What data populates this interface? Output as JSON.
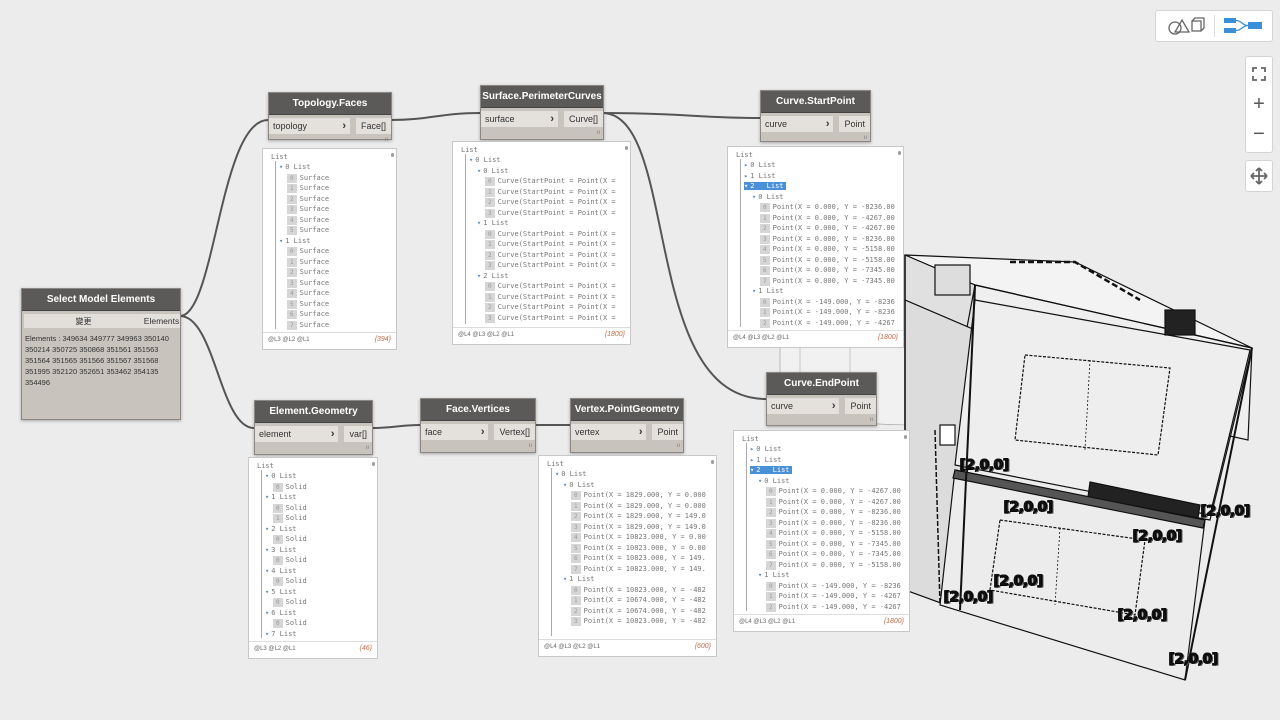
{
  "toolbar": {
    "geometry_view_icon": "shapes-icon",
    "graph_view_icon": "graph-icon",
    "fit_icon": "fit-view-icon",
    "zoom_in_label": "+",
    "zoom_out_label": "−",
    "pan_icon": "pan-icon"
  },
  "nodes": {
    "select_model": {
      "title": "Select Model Elements",
      "button": "變更",
      "output": "Elements",
      "text": "Elements : 349634 349777 349963 350140 350214 350725 350868 351561 351563 351564 351565 351566 351567 351568 351995 352120 352651 353462 354135 354496"
    },
    "topology_faces": {
      "title": "Topology.Faces",
      "input": "topology",
      "output": "Face[]",
      "watch": {
        "header": "List",
        "lines": [
          {
            "t": "▾",
            "lv": 1,
            "idx": "0",
            "text": "List"
          },
          {
            "t": "i",
            "lv": 2,
            "idx": "0",
            "text": "Surface"
          },
          {
            "t": "i",
            "lv": 2,
            "idx": "1",
            "text": "Surface"
          },
          {
            "t": "i",
            "lv": 2,
            "idx": "2",
            "text": "Surface"
          },
          {
            "t": "i",
            "lv": 2,
            "idx": "3",
            "text": "Surface"
          },
          {
            "t": "i",
            "lv": 2,
            "idx": "4",
            "text": "Surface"
          },
          {
            "t": "i",
            "lv": 2,
            "idx": "5",
            "text": "Surface"
          },
          {
            "t": "▾",
            "lv": 1,
            "idx": "1",
            "text": "List"
          },
          {
            "t": "i",
            "lv": 2,
            "idx": "0",
            "text": "Surface"
          },
          {
            "t": "i",
            "lv": 2,
            "idx": "1",
            "text": "Surface"
          },
          {
            "t": "i",
            "lv": 2,
            "idx": "2",
            "text": "Surface"
          },
          {
            "t": "i",
            "lv": 2,
            "idx": "3",
            "text": "Surface"
          },
          {
            "t": "i",
            "lv": 2,
            "idx": "4",
            "text": "Surface"
          },
          {
            "t": "i",
            "lv": 2,
            "idx": "5",
            "text": "Surface"
          },
          {
            "t": "i",
            "lv": 2,
            "idx": "6",
            "text": "Surface"
          },
          {
            "t": "i",
            "lv": 2,
            "idx": "7",
            "text": "Surface"
          }
        ],
        "levels": "@L3 @L2 @L1",
        "count": "{394}"
      }
    },
    "perimeter": {
      "title": "Surface.PerimeterCurves",
      "input": "surface",
      "output": "Curve[]",
      "watch": {
        "header": "List",
        "lines": [
          {
            "t": "▾",
            "lv": 1,
            "idx": "0",
            "text": "List"
          },
          {
            "t": "▾",
            "lv": 2,
            "idx": "0",
            "text": "List"
          },
          {
            "t": "i",
            "lv": 3,
            "idx": "0",
            "text": "Curve(StartPoint = Point(X ="
          },
          {
            "t": "i",
            "lv": 3,
            "idx": "1",
            "text": "Curve(StartPoint = Point(X ="
          },
          {
            "t": "i",
            "lv": 3,
            "idx": "2",
            "text": "Curve(StartPoint = Point(X ="
          },
          {
            "t": "i",
            "lv": 3,
            "idx": "3",
            "text": "Curve(StartPoint = Point(X ="
          },
          {
            "t": "▾",
            "lv": 2,
            "idx": "1",
            "text": "List"
          },
          {
            "t": "i",
            "lv": 3,
            "idx": "0",
            "text": "Curve(StartPoint = Point(X ="
          },
          {
            "t": "i",
            "lv": 3,
            "idx": "1",
            "text": "Curve(StartPoint = Point(X ="
          },
          {
            "t": "i",
            "lv": 3,
            "idx": "2",
            "text": "Curve(StartPoint = Point(X ="
          },
          {
            "t": "i",
            "lv": 3,
            "idx": "3",
            "text": "Curve(StartPoint = Point(X ="
          },
          {
            "t": "▾",
            "lv": 2,
            "idx": "2",
            "text": "List"
          },
          {
            "t": "i",
            "lv": 3,
            "idx": "0",
            "text": "Curve(StartPoint = Point(X ="
          },
          {
            "t": "i",
            "lv": 3,
            "idx": "1",
            "text": "Curve(StartPoint = Point(X ="
          },
          {
            "t": "i",
            "lv": 3,
            "idx": "2",
            "text": "Curve(StartPoint = Point(X ="
          },
          {
            "t": "i",
            "lv": 3,
            "idx": "3",
            "text": "Curve(StartPoint = Point(X ="
          }
        ],
        "levels": "@L4 @L3 @L2 @L1",
        "count": "{1800}"
      }
    },
    "start_point": {
      "title": "Curve.StartPoint",
      "input": "curve",
      "output": "Point",
      "watch": {
        "header": "List",
        "lines": [
          {
            "t": "▸",
            "lv": 1,
            "idx": "0",
            "text": "List"
          },
          {
            "t": "▸",
            "lv": 1,
            "idx": "1",
            "text": "List"
          },
          {
            "t": "▾",
            "lv": 1,
            "idx": "2",
            "text": "List",
            "sel": true
          },
          {
            "t": "▾",
            "lv": 2,
            "idx": "0",
            "text": "List"
          },
          {
            "t": "i",
            "lv": 3,
            "idx": "0",
            "text": "Point(X = 0.000, Y = -8236.00"
          },
          {
            "t": "i",
            "lv": 3,
            "idx": "1",
            "text": "Point(X = 0.000, Y = -4267.00"
          },
          {
            "t": "i",
            "lv": 3,
            "idx": "2",
            "text": "Point(X = 0.000, Y = -4267.00"
          },
          {
            "t": "i",
            "lv": 3,
            "idx": "3",
            "text": "Point(X = 0.000, Y = -8236.00"
          },
          {
            "t": "i",
            "lv": 3,
            "idx": "4",
            "text": "Point(X = 0.000, Y = -5158.00"
          },
          {
            "t": "i",
            "lv": 3,
            "idx": "5",
            "text": "Point(X = 0.000, Y = -5158.00"
          },
          {
            "t": "i",
            "lv": 3,
            "idx": "6",
            "text": "Point(X = 0.000, Y = -7345.00"
          },
          {
            "t": "i",
            "lv": 3,
            "idx": "7",
            "text": "Point(X = 0.000, Y = -7345.00"
          },
          {
            "t": "▾",
            "lv": 2,
            "idx": "1",
            "text": "List"
          },
          {
            "t": "i",
            "lv": 3,
            "idx": "0",
            "text": "Point(X = -149.000, Y = -8236"
          },
          {
            "t": "i",
            "lv": 3,
            "idx": "1",
            "text": "Point(X = -149.000, Y = -8236"
          },
          {
            "t": "i",
            "lv": 3,
            "idx": "2",
            "text": "Point(X = -149.000, Y = -4267"
          }
        ],
        "levels": "@L4 @L3 @L2 @L1",
        "count": "{1800}"
      }
    },
    "element_geometry": {
      "title": "Element.Geometry",
      "input": "element",
      "output": "var[]",
      "watch": {
        "header": "List",
        "lines": [
          {
            "t": "▾",
            "lv": 1,
            "idx": "0",
            "text": "List"
          },
          {
            "t": "i",
            "lv": 2,
            "idx": "0",
            "text": "Solid"
          },
          {
            "t": "▾",
            "lv": 1,
            "idx": "1",
            "text": "List"
          },
          {
            "t": "i",
            "lv": 2,
            "idx": "0",
            "text": "Solid"
          },
          {
            "t": "i",
            "lv": 2,
            "idx": "1",
            "text": "Solid"
          },
          {
            "t": "▾",
            "lv": 1,
            "idx": "2",
            "text": "List"
          },
          {
            "t": "i",
            "lv": 2,
            "idx": "0",
            "text": "Solid"
          },
          {
            "t": "▾",
            "lv": 1,
            "idx": "3",
            "text": "List"
          },
          {
            "t": "i",
            "lv": 2,
            "idx": "0",
            "text": "Solid"
          },
          {
            "t": "▾",
            "lv": 1,
            "idx": "4",
            "text": "List"
          },
          {
            "t": "i",
            "lv": 2,
            "idx": "0",
            "text": "Solid"
          },
          {
            "t": "▾",
            "lv": 1,
            "idx": "5",
            "text": "List"
          },
          {
            "t": "i",
            "lv": 2,
            "idx": "0",
            "text": "Solid"
          },
          {
            "t": "▾",
            "lv": 1,
            "idx": "6",
            "text": "List"
          },
          {
            "t": "i",
            "lv": 2,
            "idx": "0",
            "text": "Solid"
          },
          {
            "t": "▾",
            "lv": 1,
            "idx": "7",
            "text": "List"
          },
          {
            "t": "i",
            "lv": 2,
            "idx": "0",
            "text": "Solid"
          }
        ],
        "levels": "@L3 @L2 @L1",
        "count": "{46}"
      }
    },
    "face_vertices": {
      "title": "Face.Vertices",
      "input": "face",
      "output": "Vertex[]"
    },
    "vertex_point": {
      "title": "Vertex.PointGeometry",
      "input": "vertex",
      "output": "Point",
      "watch": {
        "header": "List",
        "lines": [
          {
            "t": "▾",
            "lv": 1,
            "idx": "0",
            "text": "List"
          },
          {
            "t": "▾",
            "lv": 2,
            "idx": "0",
            "text": "List"
          },
          {
            "t": "i",
            "lv": 3,
            "idx": "0",
            "text": "Point(X = 1829.000, Y = 0.000"
          },
          {
            "t": "i",
            "lv": 3,
            "idx": "1",
            "text": "Point(X = 1829.000, Y = 0.000"
          },
          {
            "t": "i",
            "lv": 3,
            "idx": "2",
            "text": "Point(X = 1829.000, Y = 149.0"
          },
          {
            "t": "i",
            "lv": 3,
            "idx": "3",
            "text": "Point(X = 1829.000, Y = 149.0"
          },
          {
            "t": "i",
            "lv": 3,
            "idx": "4",
            "text": "Point(X = 10823.000, Y = 0.00"
          },
          {
            "t": "i",
            "lv": 3,
            "idx": "5",
            "text": "Point(X = 10823.000, Y = 0.00"
          },
          {
            "t": "i",
            "lv": 3,
            "idx": "6",
            "text": "Point(X = 10823.000, Y = 149."
          },
          {
            "t": "i",
            "lv": 3,
            "idx": "7",
            "text": "Point(X = 10823.000, Y = 149."
          },
          {
            "t": "▾",
            "lv": 2,
            "idx": "1",
            "text": "List"
          },
          {
            "t": "i",
            "lv": 3,
            "idx": "0",
            "text": "Point(X = 10823.000, Y = -482"
          },
          {
            "t": "i",
            "lv": 3,
            "idx": "1",
            "text": "Point(X = 10674.000, Y = -482"
          },
          {
            "t": "i",
            "lv": 3,
            "idx": "2",
            "text": "Point(X = 10674.000, Y = -482"
          },
          {
            "t": "i",
            "lv": 3,
            "idx": "3",
            "text": "Point(X = 10823.000, Y = -482"
          }
        ],
        "levels": "@L4 @L3 @L2 @L1",
        "count": "{600}"
      }
    },
    "end_point": {
      "title": "Curve.EndPoint",
      "input": "curve",
      "output": "Point",
      "watch": {
        "header": "List",
        "lines": [
          {
            "t": "▸",
            "lv": 1,
            "idx": "0",
            "text": "List"
          },
          {
            "t": "▸",
            "lv": 1,
            "idx": "1",
            "text": "List"
          },
          {
            "t": "▾",
            "lv": 1,
            "idx": "2",
            "text": "List",
            "sel": true
          },
          {
            "t": "▾",
            "lv": 2,
            "idx": "0",
            "text": "List"
          },
          {
            "t": "i",
            "lv": 3,
            "idx": "0",
            "text": "Point(X = 0.000, Y = -4267.00"
          },
          {
            "t": "i",
            "lv": 3,
            "idx": "1",
            "text": "Point(X = 0.000, Y = -4267.00"
          },
          {
            "t": "i",
            "lv": 3,
            "idx": "2",
            "text": "Point(X = 0.000, Y = -8236.00"
          },
          {
            "t": "i",
            "lv": 3,
            "idx": "3",
            "text": "Point(X = 0.000, Y = -8236.00"
          },
          {
            "t": "i",
            "lv": 3,
            "idx": "4",
            "text": "Point(X = 0.000, Y = -5158.00"
          },
          {
            "t": "i",
            "lv": 3,
            "idx": "5",
            "text": "Point(X = 0.000, Y = -7345.00"
          },
          {
            "t": "i",
            "lv": 3,
            "idx": "6",
            "text": "Point(X = 0.000, Y = -7345.00"
          },
          {
            "t": "i",
            "lv": 3,
            "idx": "7",
            "text": "Point(X = 0.000, Y = -5158.00"
          },
          {
            "t": "▾",
            "lv": 2,
            "idx": "1",
            "text": "List"
          },
          {
            "t": "i",
            "lv": 3,
            "idx": "0",
            "text": "Point(X = -149.000, Y = -8236"
          },
          {
            "t": "i",
            "lv": 3,
            "idx": "1",
            "text": "Point(X = -149.000, Y = -4267"
          },
          {
            "t": "i",
            "lv": 3,
            "idx": "2",
            "text": "Point(X = -149.000, Y = -4267"
          }
        ],
        "levels": "@L4 @L3 @L2 @L1",
        "count": "{1800}"
      }
    }
  },
  "geometry_labels": [
    "[2,0,0]",
    "[2,0,0]",
    "[2,0,0]",
    "[2,0,0]",
    "[2,0,0]",
    "[2,0,0]",
    "[2,0,0]",
    "[2,0,0]"
  ],
  "colors": {
    "node_header": "#5c5a58",
    "node_body": "#c8c3bc",
    "wire": "#555555",
    "selection": "#4a90d9",
    "count": "#c46c4c"
  }
}
